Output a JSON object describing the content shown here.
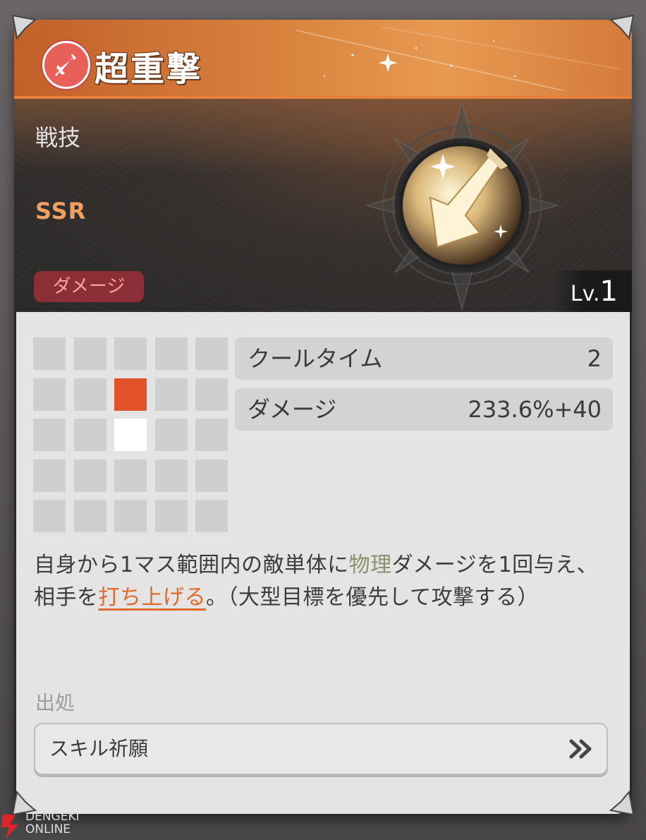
{
  "skill": {
    "title": "超重撃",
    "category": "戦技",
    "rarity": "SSR",
    "tag": "ダメージ",
    "level_prefix": "Lv.",
    "level_value": "1"
  },
  "stats": [
    {
      "label": "クールタイム",
      "value": "2"
    },
    {
      "label": "ダメージ",
      "value": "233.6%+40"
    }
  ],
  "range_grid": {
    "rows": 5,
    "cols": 5,
    "target_cell": [
      1,
      2
    ],
    "self_cell": [
      2,
      2
    ]
  },
  "description": {
    "part1": "自身から1マス範囲内の敵単体に",
    "keyword1": "物理",
    "part2": "ダメージを1回与え、相手を",
    "keyword2": "打ち上げる",
    "part3": "。（大型目標を優先して攻撃する）"
  },
  "source": {
    "label": "出処",
    "button_label": "スキル祈願"
  },
  "watermark": {
    "line1": "DENGEKI",
    "line2": "ONLINE"
  },
  "colors": {
    "header_orange": "#d9843f",
    "tag_bg": "#8c2e36",
    "target_cell": "#e4522a",
    "self_cell": "#ffffff",
    "keyword_green": "#88936c",
    "keyword_orange": "#e06a2a"
  }
}
